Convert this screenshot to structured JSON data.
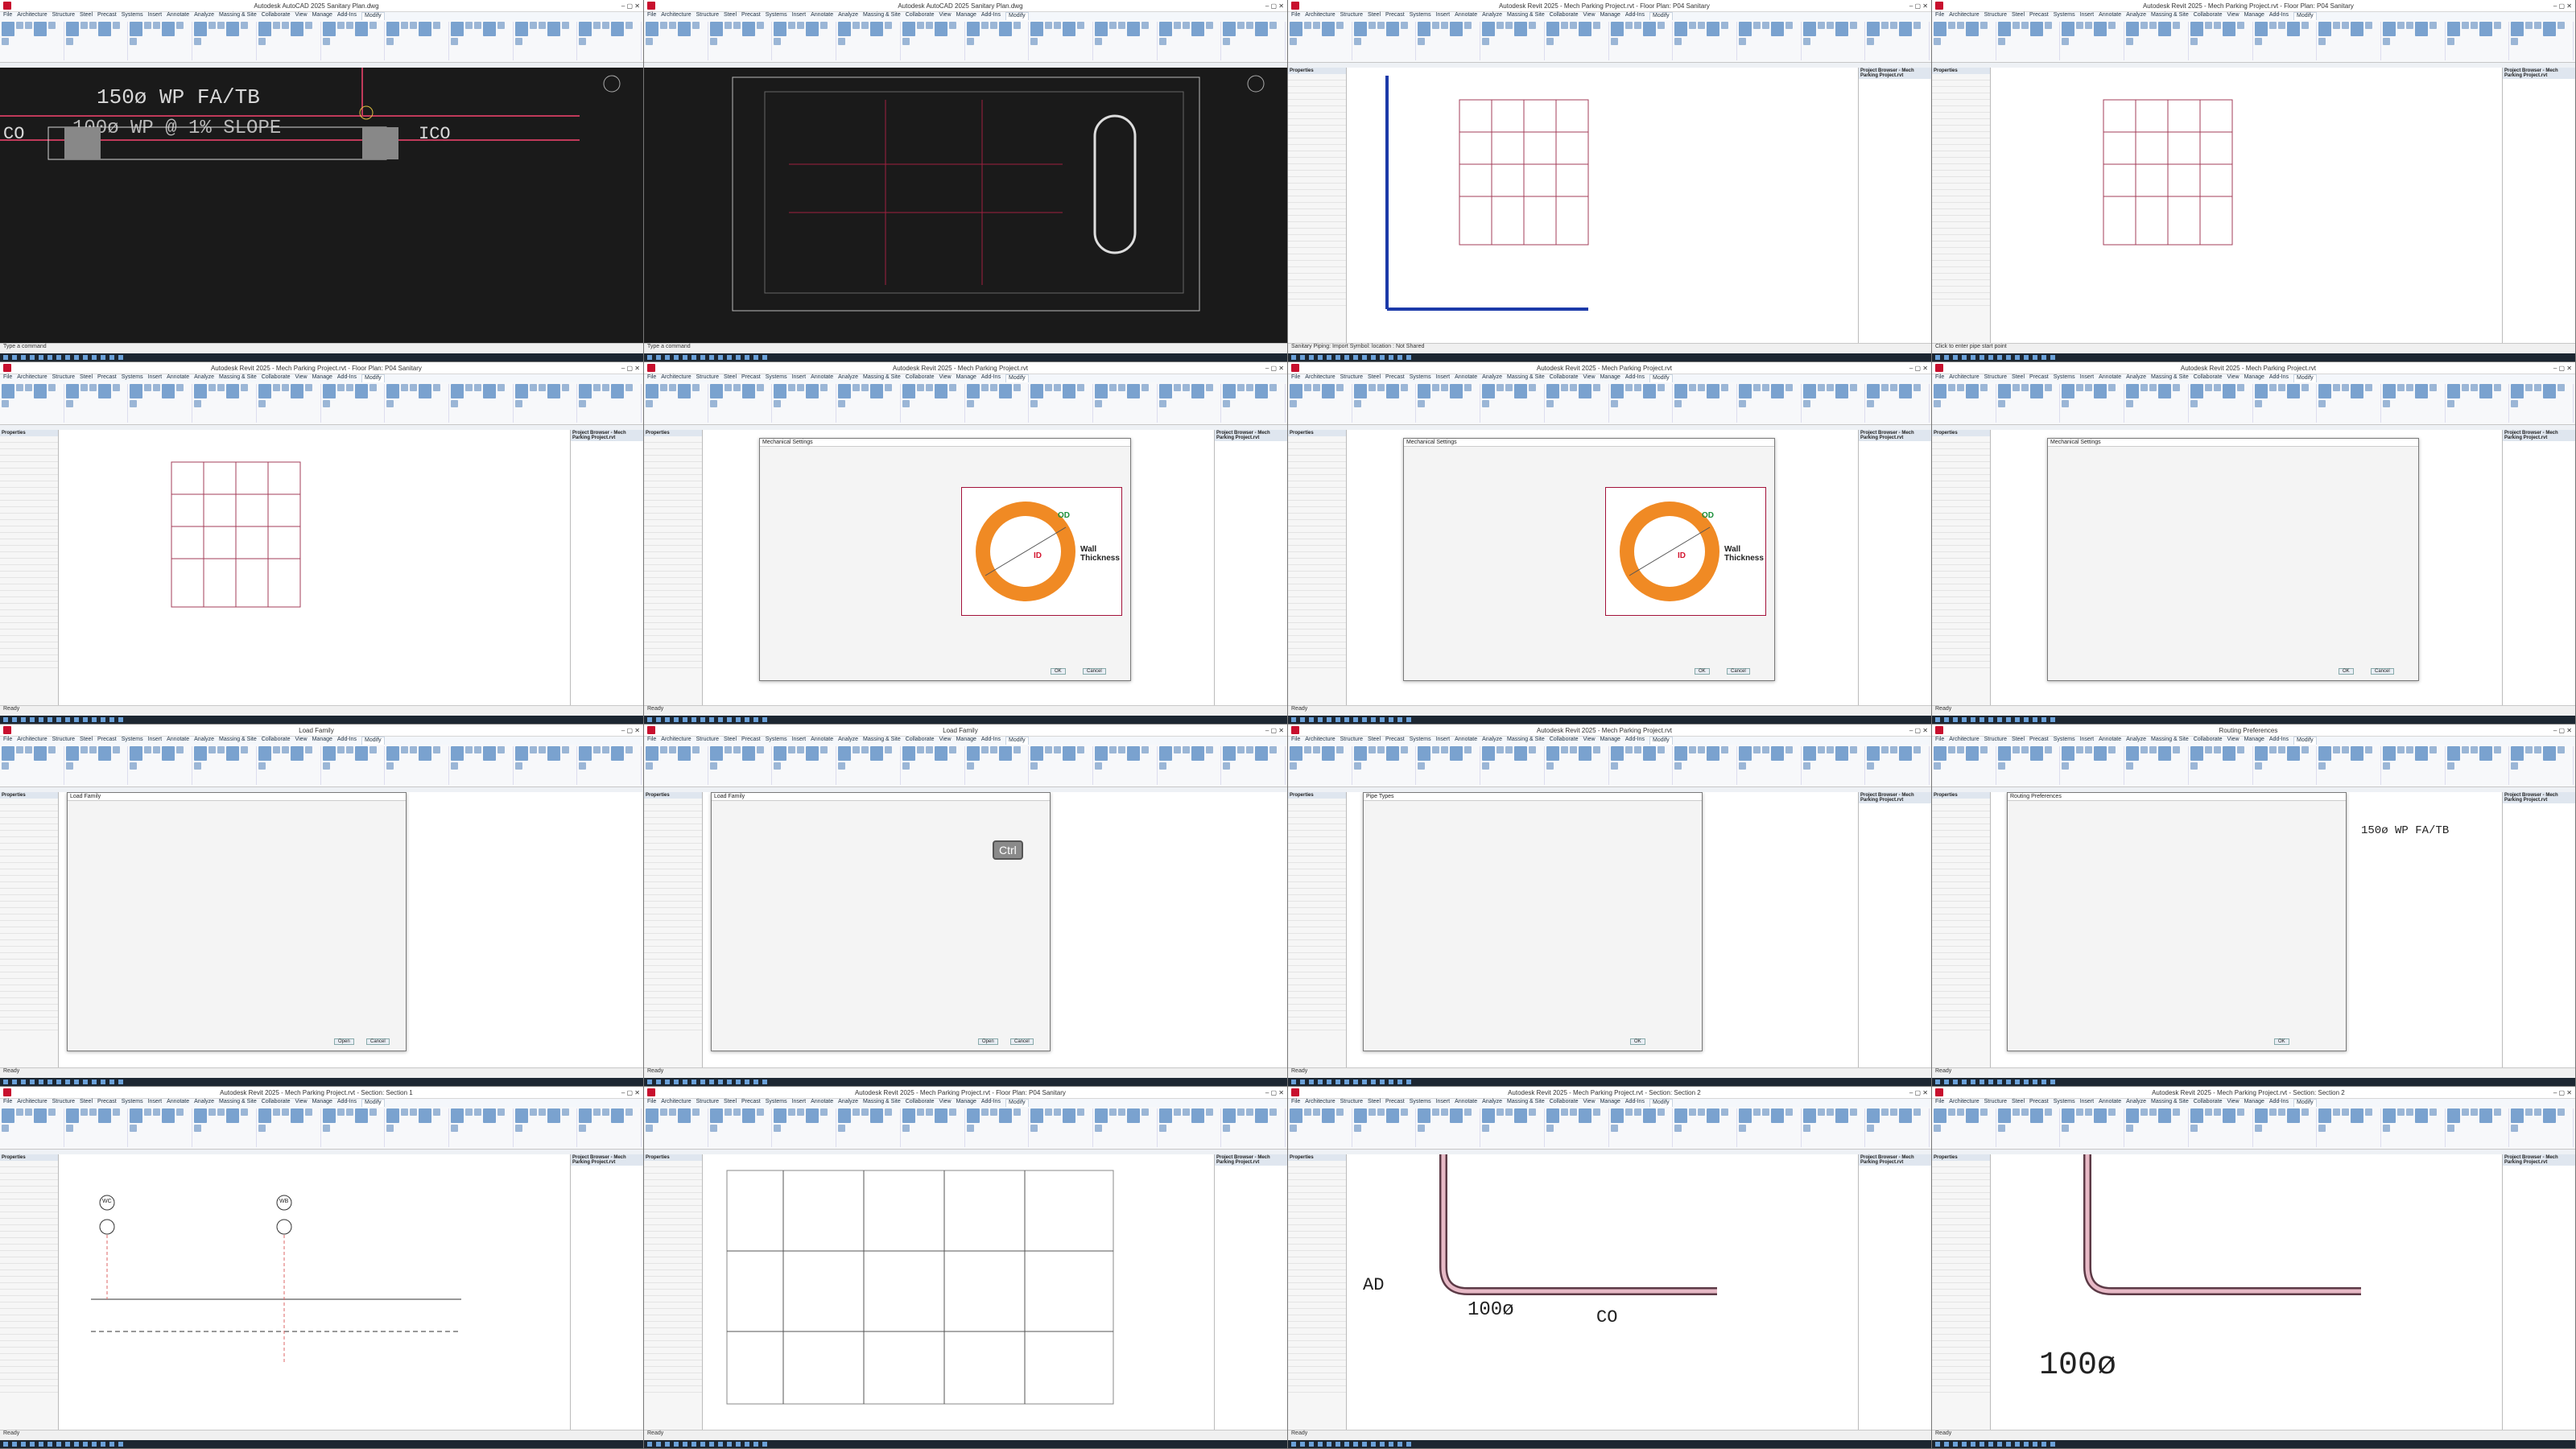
{
  "tiles": [
    {
      "app_title": "Autodesk AutoCAD 2025  Sanitary Plan.dwg",
      "status": "Type a command"
    },
    {
      "app_title": "Autodesk AutoCAD 2025  Sanitary Plan.dwg",
      "status": "Type a command"
    },
    {
      "app_title": "Autodesk Revit 2025 - Mech Parking Project.rvt - Floor Plan: P04 Sanitary",
      "status": "Sanitary Piping: Import Symbol: location : Not Shared"
    },
    {
      "app_title": "Autodesk Revit 2025 - Mech Parking Project.rvt - Floor Plan: P04 Sanitary",
      "status": "Click to enter pipe start point"
    },
    {
      "app_title": "Autodesk Revit 2025 - Mech Parking Project.rvt - Floor Plan: P04 Sanitary",
      "status": "Ready"
    },
    {
      "app_title": "Autodesk Revit 2025 - Mech Parking Project.rvt",
      "status": "Ready"
    },
    {
      "app_title": "Autodesk Revit 2025 - Mech Parking Project.rvt",
      "status": "Ready"
    },
    {
      "app_title": "Autodesk Revit 2025 - Mech Parking Project.rvt",
      "status": "Ready"
    },
    {
      "app_title": "Load Family",
      "status": "Ready"
    },
    {
      "app_title": "Load Family",
      "status": "Ready"
    },
    {
      "app_title": "Autodesk Revit 2025 - Mech Parking Project.rvt",
      "status": "Ready"
    },
    {
      "app_title": "Routing Preferences",
      "status": "Ready"
    },
    {
      "app_title": "Autodesk Revit 2025 - Mech Parking Project.rvt - Section: Section 1",
      "status": "Ready"
    },
    {
      "app_title": "Autodesk Revit 2025 - Mech Parking Project.rvt - Floor Plan: P04 Sanitary",
      "status": "Ready"
    },
    {
      "app_title": "Autodesk Revit 2025 - Mech Parking Project.rvt - Section: Section 2",
      "status": "Ready"
    },
    {
      "app_title": "Autodesk Revit 2025 - Mech Parking Project.rvt - Section: Section 2",
      "status": "Ready"
    }
  ],
  "ribbon_tabs": [
    "File",
    "Architecture",
    "Structure",
    "Steel",
    "Precast",
    "Systems",
    "Insert",
    "Annotate",
    "Analyze",
    "Massing & Site",
    "Collaborate",
    "View",
    "Manage",
    "Add-Ins",
    "Modify"
  ],
  "cad_labels": {
    "line1": "150ø WP FA/TB",
    "line2": "100ø WP @ 1% SLOPE",
    "co": "CO",
    "ico": "ICO"
  },
  "dialog_titles": {
    "mech": "Mechanical Settings",
    "load": "Load Family",
    "routing": "Routing Preferences",
    "pipe_types": "Pipe Types"
  },
  "dialog_buttons": {
    "ok": "OK",
    "cancel": "Cancel",
    "open": "Open"
  },
  "pipe_diagram": {
    "od": "OD",
    "id": "ID",
    "wall": "Wall Thickness"
  },
  "ctrl_key": "Ctrl",
  "section_labels": {
    "ad": "AD",
    "size": "100ø",
    "co": "CO",
    "wc": "WC",
    "wb": "WB"
  },
  "props_header": "Properties",
  "browser_header": "Project Browser - Mech Parking Project.rvt"
}
